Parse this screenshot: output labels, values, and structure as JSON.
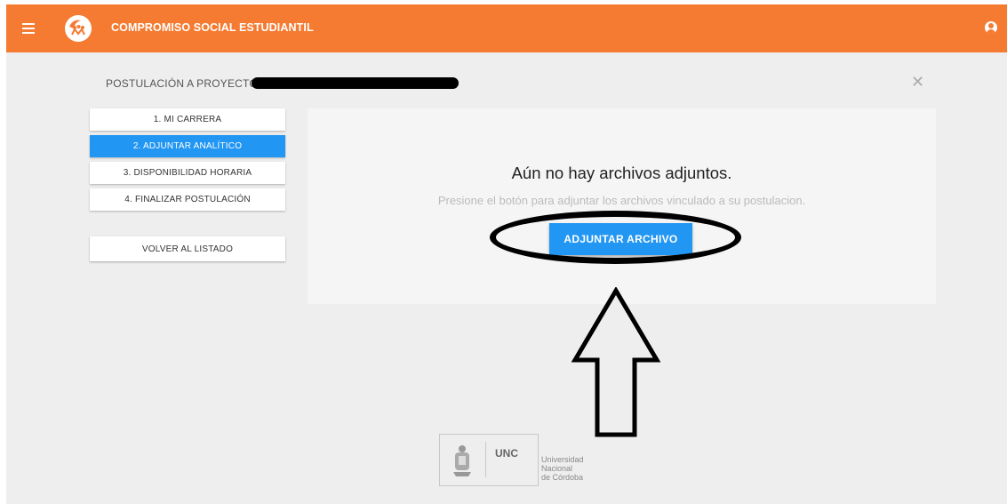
{
  "topbar": {
    "app_title": "COMPROMISO SOCIAL ESTUDIANTIL",
    "menu_icon": "hamburger-icon",
    "user_icon": "user-account-icon",
    "brand_color": "#f47b31"
  },
  "header": {
    "title": "POSTULACIÓN A PROYECTO"
  },
  "steps": [
    {
      "label": "1. MI CARRERA",
      "active": false
    },
    {
      "label": "2. ADJUNTAR ANALÍTICO",
      "active": true
    },
    {
      "label": "3. DISPONIBILIDAD HORARIA",
      "active": false
    },
    {
      "label": "4. FINALIZAR POSTULACIÓN",
      "active": false
    }
  ],
  "back_button": "VOLVER AL LISTADO",
  "main": {
    "empty_title": "Aún no hay archivos adjuntos.",
    "empty_subtitle": "Presione el botón para adjuntar los archivos vinculado a su postulacion.",
    "attach_button": "ADJUNTAR ARCHIVO",
    "accent_color": "#2196f3"
  },
  "footer": {
    "unc_label": "UNC",
    "university_line1": "Universidad",
    "university_line2": "Nacional",
    "university_line3": "de Córdoba"
  }
}
